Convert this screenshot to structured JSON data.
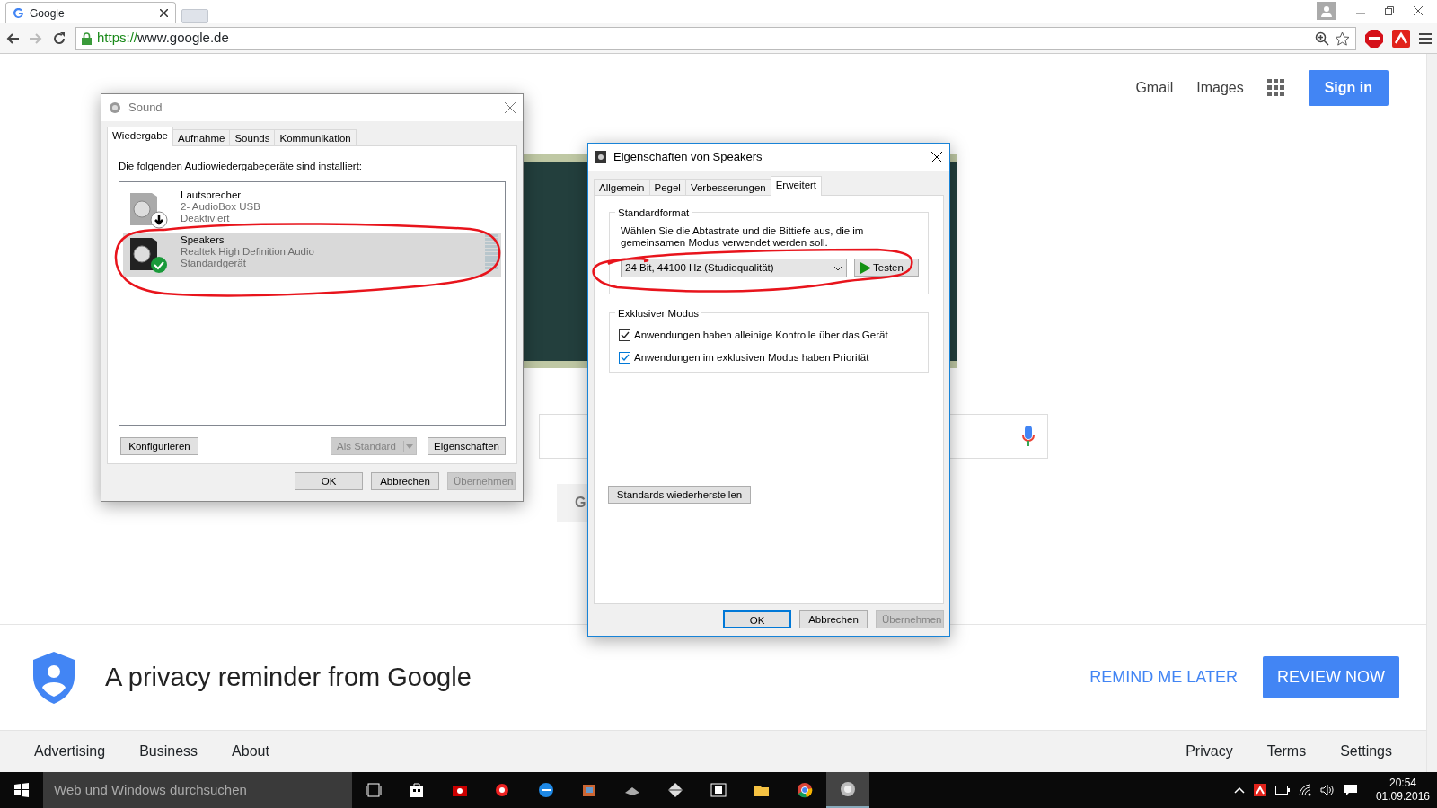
{
  "browser": {
    "tab_title": "Google",
    "url_scheme": "https://",
    "url_host": "www.google.de"
  },
  "google": {
    "header_links": [
      "Gmail",
      "Images"
    ],
    "sign_in": "Sign in",
    "search_button_partial": "G",
    "privacy": {
      "message": "A privacy reminder from Google",
      "remind": "REMIND ME LATER",
      "review": "REVIEW NOW"
    },
    "footer_left": [
      "Advertising",
      "Business",
      "About"
    ],
    "footer_right": [
      "Privacy",
      "Terms",
      "Settings"
    ]
  },
  "sound_dialog": {
    "title": "Sound",
    "tabs": [
      {
        "label": "Wiedergabe",
        "selected": true
      },
      {
        "label": "Aufnahme",
        "selected": false
      },
      {
        "label": "Sounds",
        "selected": false
      },
      {
        "label": "Kommunikation",
        "selected": false
      }
    ],
    "instruction": "Die folgenden Audiowiedergabegeräte sind installiert:",
    "devices": [
      {
        "name": "Lautsprecher",
        "driver": "2- AudioBox USB",
        "status": "Deaktiviert",
        "kind": "disabled",
        "selected": false
      },
      {
        "name": "Speakers",
        "driver": "Realtek High Definition Audio",
        "status": "Standardgerät",
        "kind": "default",
        "selected": true
      }
    ],
    "buttons": [
      {
        "label": "Konfigurieren",
        "kind": "plain",
        "disabled": false
      },
      {
        "label": "Als Standard",
        "kind": "split",
        "disabled": true
      },
      {
        "label": "Eigenschaften",
        "kind": "plain",
        "disabled": false
      }
    ],
    "footer_buttons": [
      {
        "label": "OK",
        "disabled": false
      },
      {
        "label": "Abbrechen",
        "disabled": false
      },
      {
        "label": "Übernehmen",
        "disabled": true
      }
    ]
  },
  "properties_dialog": {
    "title": "Eigenschaften von Speakers",
    "tabs": [
      {
        "label": "Allgemein",
        "selected": false
      },
      {
        "label": "Pegel",
        "selected": false
      },
      {
        "label": "Verbesserungen",
        "selected": false
      },
      {
        "label": "Erweitert",
        "selected": true
      }
    ],
    "standard_format": {
      "legend": "Standardformat",
      "description": "Wählen Sie die Abtastrate und die Bittiefe aus, die im gemeinsamen Modus verwendet werden soll.",
      "format_value": "24 Bit, 44100 Hz (Studioqualität)",
      "test_button": "Testen"
    },
    "exclusive_mode": {
      "legend": "Exklusiver Modus",
      "options": [
        {
          "label": "Anwendungen haben alleinige Kontrolle über das Gerät",
          "checked": true
        },
        {
          "label": "Anwendungen im exklusiven Modus haben Priorität",
          "checked": true
        }
      ]
    },
    "restore_button": "Standards wiederherstellen",
    "footer_buttons": [
      {
        "label": "OK",
        "disabled": false
      },
      {
        "label": "Abbrechen",
        "disabled": false
      },
      {
        "label": "Übernehmen",
        "disabled": true
      }
    ]
  },
  "taskbar": {
    "search_placeholder": "Web und Windows durchsuchen",
    "time": "20:54",
    "date": "01.09.2016"
  }
}
